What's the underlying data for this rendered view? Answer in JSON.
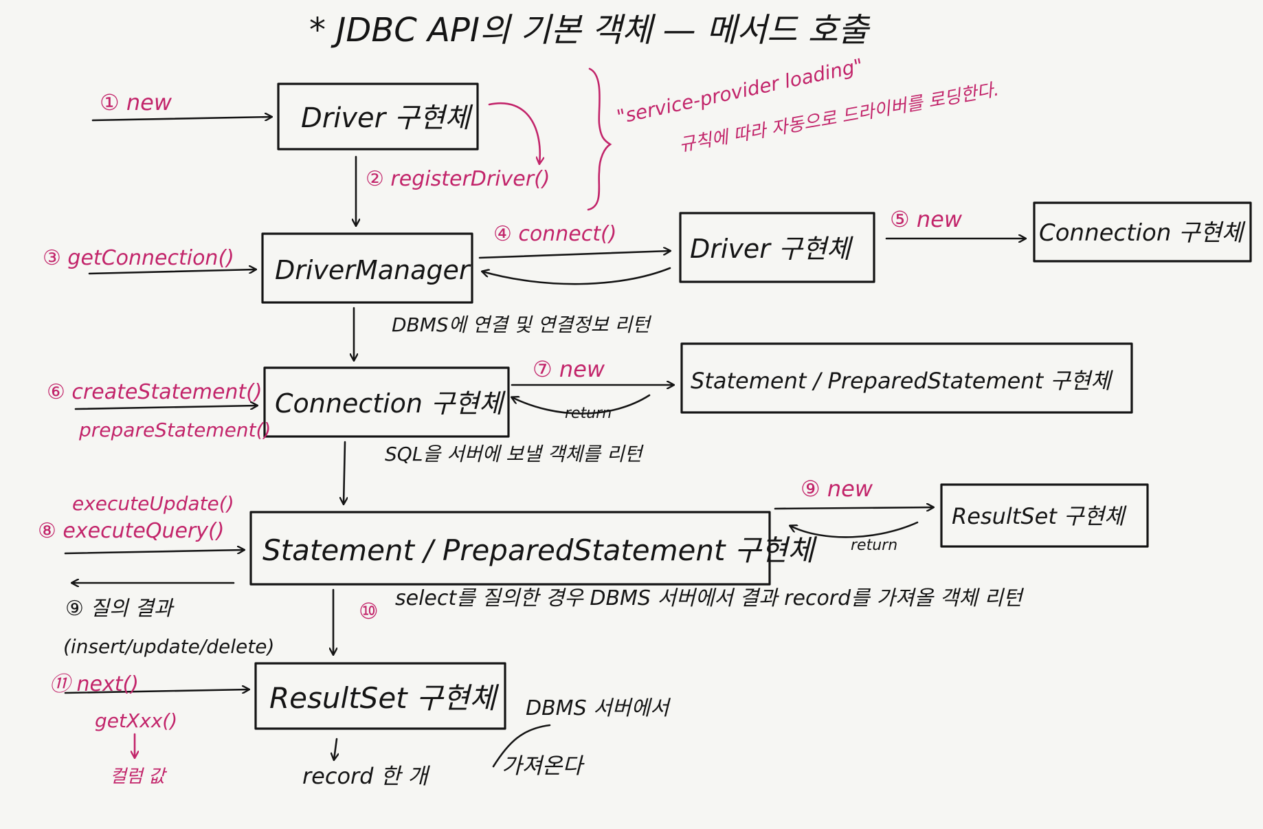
{
  "title": "* JDBC API의 기본 객체 — 메서드 호출",
  "colors": {
    "ink": "#141414",
    "accent": "#c2246a",
    "paper": "#f6f6f3"
  },
  "boxes": {
    "driver_impl_1": "Driver 구현체",
    "driver_manager": "DriverManager",
    "driver_impl_2": "Driver 구현체",
    "connection_impl_right": "Connection 구현체",
    "connection_impl": "Connection 구현체",
    "statement_impl_right": "Statement / PreparedStatement 구현체",
    "statement_impl": "Statement / PreparedStatement 구현체",
    "resultset_impl_right": "ResultSet 구현체",
    "resultset_impl": "ResultSet 구현체"
  },
  "steps": {
    "s1": "① new",
    "s2": "② registerDriver()",
    "s3": "③ getConnection()",
    "s4": "④ connect()",
    "s5": "⑤ new",
    "s6a": "⑥ createStatement()",
    "s6b": "prepareStatement()",
    "s7": "⑦ new",
    "s8a": "executeUpdate()",
    "s8b": "⑧ executeQuery()",
    "s9": "⑨ new",
    "s11a": "⑪ next()",
    "s11b": "getXxx()",
    "s11c": "컬럼 값",
    "s10": "⑩"
  },
  "notes": {
    "spi_line1": "\"service-provider loading\"",
    "spi_line2": "규칙에 따라 자동으로 드라이버를 로딩한다.",
    "dbms_connect": "DBMS에 연결 및 연결정보 리턴",
    "sql_send": "SQL을 서버에 보낼 객체를 리턴",
    "return_1": "return",
    "return_2": "return",
    "select_note": "select를 질의한 경우  DBMS 서버에서 결과 record를 가져올 객체 리턴",
    "query_result_1": "⑨ 질의 결과",
    "query_result_2": "(insert/update/delete)",
    "record_one": "record 한 개",
    "from_dbms": "DBMS 서버에서",
    "fetch": "가져온다"
  }
}
